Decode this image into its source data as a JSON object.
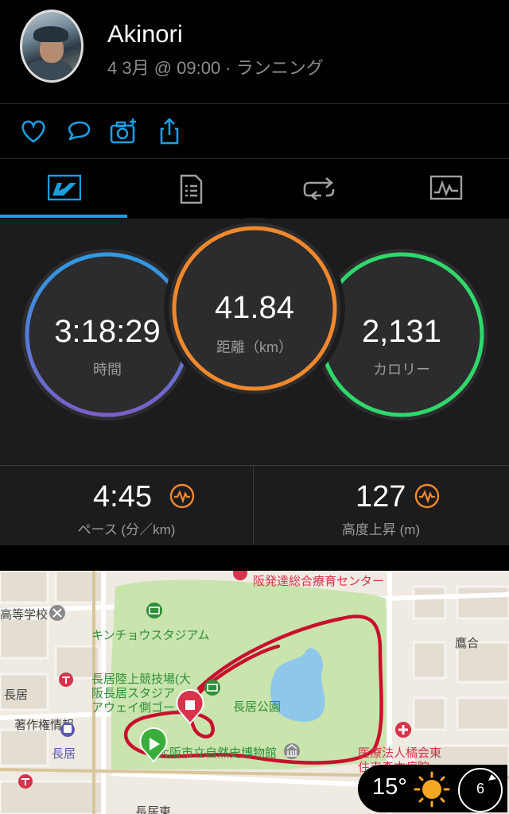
{
  "header": {
    "user_name": "Akinori",
    "activity_meta": "4 3月 @ 09:00 · ランニング"
  },
  "actions": [
    "heart-icon",
    "comment-icon",
    "add-photo-icon",
    "share-icon"
  ],
  "tabs": {
    "items": [
      "summary-tab-icon",
      "details-tab-icon",
      "laps-tab-icon",
      "charts-tab-icon"
    ],
    "active_index": 0
  },
  "summary": {
    "time": {
      "value": "3:18:29",
      "label": "時間"
    },
    "distance": {
      "value": "41.84",
      "label": "距離（km）"
    },
    "calories": {
      "value": "2,131",
      "label": "カロリー"
    }
  },
  "stats": {
    "pace": {
      "value": "4:45",
      "label": "ペース (分／km)"
    },
    "elevation": {
      "value": "127",
      "label": "高度上昇 (m)"
    }
  },
  "map": {
    "labels": {
      "center_top": "阪発達総合療育センター",
      "school": "高等学校",
      "stadium": "キンチョウスタジアム",
      "takai": "鷹合",
      "nagai_left": "長居",
      "athletic_1": "長居陸上競技場(大",
      "athletic_2": "阪長居スタジア",
      "athletic_3": "アウェイ側ゴール",
      "park": "長居公園",
      "copyright": "著作権情報",
      "nagai_station": "長居",
      "museum": "大阪市立自然史博物館",
      "medical_1": "医療法人橘会東",
      "medical_2": "住吉森本病院",
      "nagai_east": "長居東"
    },
    "colors": {
      "park": "#c9e4ad",
      "route": "#c8102e",
      "labels_green": "#2f8f3a",
      "labels_red": "#d8334a"
    }
  },
  "weather": {
    "temperature": "15°",
    "wind_speed": "6"
  },
  "colors": {
    "time_ring": [
      "#2f9be3",
      "#7a5fc8"
    ],
    "distance_ring": "#f0892c",
    "calories_ring": "#2fd86b",
    "accent_blue": "#1a9fe0",
    "chart_icon": "#f0892c"
  }
}
